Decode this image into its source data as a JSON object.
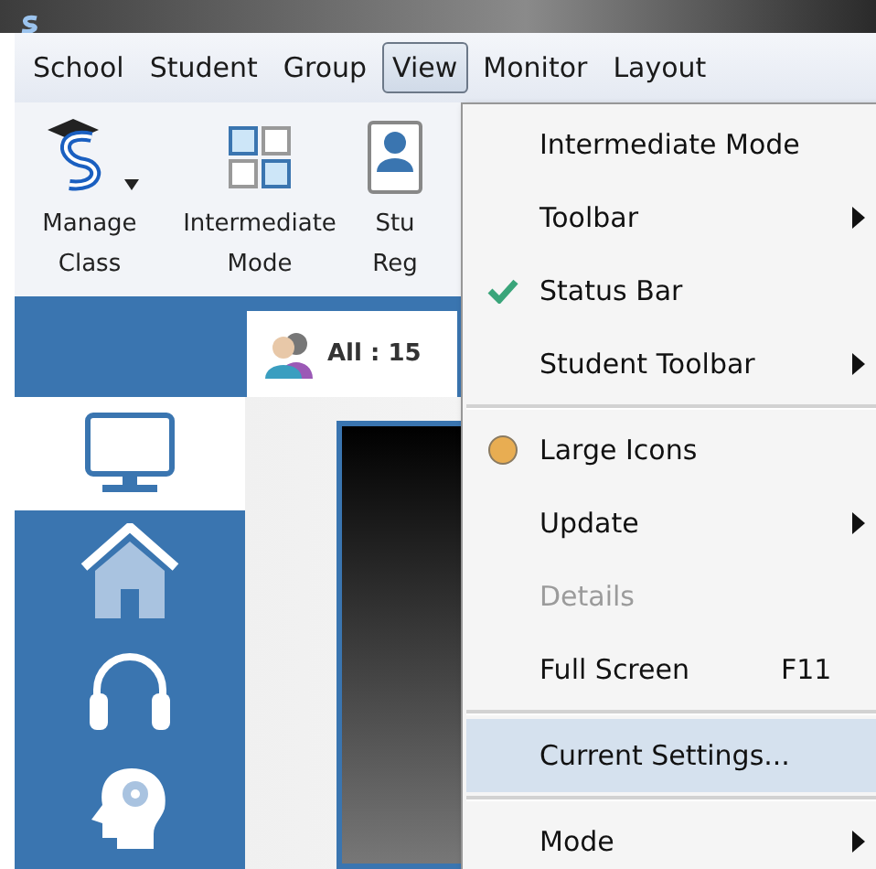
{
  "menu_bar": [
    {
      "label": "School",
      "selected": false
    },
    {
      "label": "Student",
      "selected": false
    },
    {
      "label": "Group",
      "selected": false
    },
    {
      "label": "View",
      "selected": true
    },
    {
      "label": "Monitor",
      "selected": false
    },
    {
      "label": "Layout",
      "selected": false
    }
  ],
  "toolbar": [
    {
      "lines": [
        "Manage",
        "Class"
      ],
      "dropdown": true
    },
    {
      "lines": [
        "Intermediate",
        "Mode"
      ],
      "dropdown": false
    },
    {
      "lines": [
        "Stu",
        "Reg"
      ],
      "dropdown": false
    }
  ],
  "group_tab": {
    "label": "All : 15",
    "selected": true
  },
  "sidebar": [
    {
      "selected": true
    },
    {
      "selected": false
    },
    {
      "selected": false
    },
    {
      "selected": false
    }
  ],
  "view_menu": [
    {
      "kind": "item",
      "label": "Intermediate Mode",
      "disabled": false,
      "highlighted": false,
      "submenu": false
    },
    {
      "kind": "item",
      "label": "Toolbar",
      "disabled": false,
      "highlighted": false,
      "submenu": true
    },
    {
      "kind": "check",
      "label": "Status Bar",
      "checked": true,
      "disabled": false,
      "highlighted": false,
      "submenu": false
    },
    {
      "kind": "item",
      "label": "Student Toolbar",
      "disabled": false,
      "highlighted": false,
      "submenu": true
    },
    {
      "kind": "separator"
    },
    {
      "kind": "radio",
      "label": "Large Icons",
      "checked": true,
      "disabled": false,
      "highlighted": false,
      "submenu": false
    },
    {
      "kind": "item",
      "label": "Update",
      "disabled": false,
      "highlighted": false,
      "submenu": true
    },
    {
      "kind": "item",
      "label": "Details",
      "disabled": true,
      "highlighted": false,
      "submenu": false
    },
    {
      "kind": "item",
      "label": "Full Screen",
      "shortcut": "F11",
      "disabled": false,
      "highlighted": false,
      "submenu": false
    },
    {
      "kind": "separator"
    },
    {
      "kind": "item",
      "label": "Current Settings...",
      "disabled": false,
      "highlighted": true,
      "submenu": false
    },
    {
      "kind": "separator"
    },
    {
      "kind": "item",
      "label": "Mode",
      "disabled": false,
      "highlighted": false,
      "submenu": true
    }
  ]
}
